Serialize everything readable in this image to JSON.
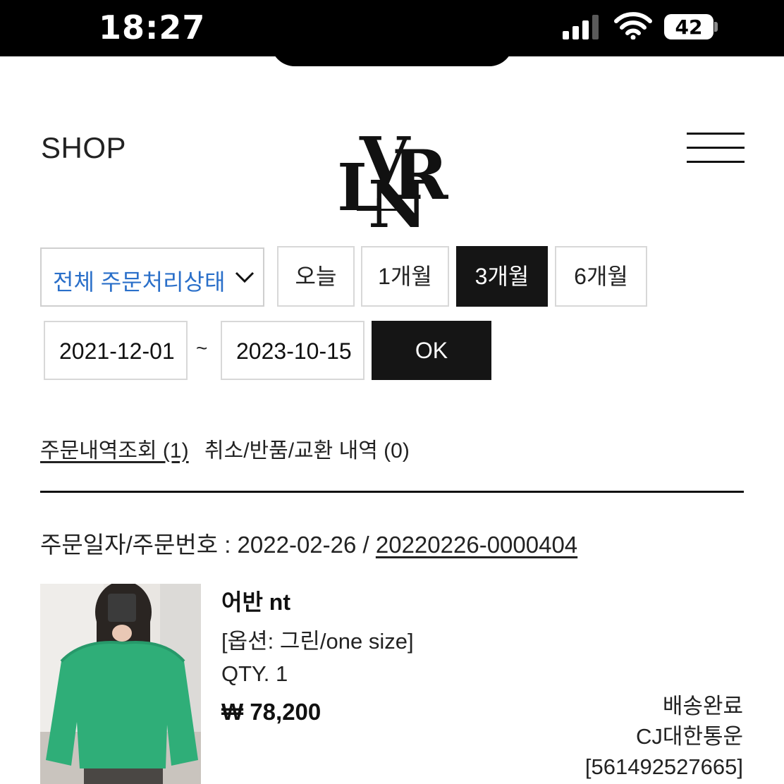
{
  "status_bar": {
    "time": "18:27",
    "battery": "42",
    "icons": [
      "cellular-signal-icon",
      "wifi-icon",
      "battery-icon"
    ]
  },
  "header": {
    "shop_label": "SHOP",
    "menu_icon": "hamburger-menu-icon"
  },
  "filters": {
    "status_select": "전체 주문처리상태",
    "periods": [
      {
        "label": "오늘",
        "active": false
      },
      {
        "label": "1개월",
        "active": false
      },
      {
        "label": "3개월",
        "active": true
      },
      {
        "label": "6개월",
        "active": false
      }
    ],
    "start_date": "2021-12-01",
    "separator": "~",
    "end_date": "2023-10-15",
    "ok_label": "OK"
  },
  "tabs": {
    "order_history": "주문내역조회 (1)",
    "cancel_return": "취소/반품/교환 내역 (0)"
  },
  "order": {
    "prefix": "주문일자/주문번호 : 2022-02-26 / ",
    "order_number": "20220226-0000404",
    "product": {
      "name": "어반 nt",
      "option": "[옵션: 그린/one size]",
      "qty": "QTY. 1",
      "price": "₩ 78,200"
    },
    "shipping": {
      "status": "배송완료",
      "carrier": "CJ대한통운",
      "tracking": "[561492527665]"
    }
  },
  "colors": {
    "accent_blue": "#2a6fc9",
    "active_button": "#151515",
    "sweater_green": "#2fae78"
  }
}
